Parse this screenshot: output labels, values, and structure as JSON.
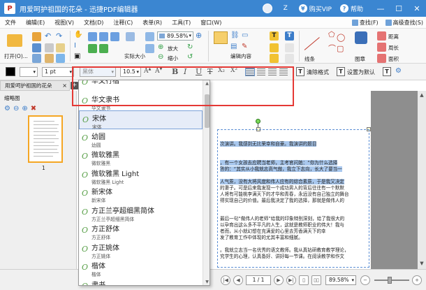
{
  "titlebar": {
    "logo_text": "P",
    "title": "用爱呵护祖国的花朵 - 迅捷PDF编辑器",
    "user_letter": "Z",
    "buy_vip": "购买VIP",
    "help": "帮助",
    "minimize": "—",
    "maximize": "☐",
    "close": "✕"
  },
  "menu": {
    "items": [
      "文件",
      "编辑(E)",
      "视图(V)",
      "文档(D)",
      "注释(C)",
      "表单(R)",
      "工具(T)",
      "窗口(W)"
    ],
    "search": "查找(F)",
    "advanced_search": "高级查找(S)"
  },
  "ribbon": {
    "open_label": "打开(O)...",
    "zoom_value": "89.58%",
    "actual_size": "实际大小",
    "zoom_in": "放大",
    "zoom_out": "缩小",
    "edit_content": "编辑内容",
    "line": "线条",
    "shape": "图章",
    "distance": "距离",
    "perimeter": "周长",
    "area": "面积"
  },
  "format": {
    "line_width": "1 pt",
    "font_placeholder": "黑体",
    "font_size": "10.5",
    "bold": "B",
    "italic": "I",
    "underline": "U",
    "strike": "T",
    "sub": "X₂",
    "sup": "X²",
    "clear_format": "清除格式",
    "set_default": "设置为默认"
  },
  "left_panel": {
    "tab_label": "用爱呵护祖国的花朵",
    "tab_close": "×",
    "tab_add": "+",
    "panel_title": "缩略图",
    "page_number": "1"
  },
  "font_dropdown": {
    "items": [
      {
        "name": "华文行楷",
        "sub": "",
        "style": "serif"
      },
      {
        "name": "华文隶书",
        "sub": "华文隶书",
        "style": "serif"
      },
      {
        "name": "宋体",
        "sub": "宋体",
        "style": "serif"
      },
      {
        "name": "幼圆",
        "sub": "幼圆",
        "style": "sans"
      },
      {
        "name": "微软雅黑",
        "sub": "微软雅黑",
        "style": "sans"
      },
      {
        "name": "微软雅黑 Light",
        "sub": "微软雅黑 Light",
        "style": "sans"
      },
      {
        "name": "新宋体",
        "sub": "新宋体",
        "style": "serif"
      },
      {
        "name": "方正兰亭超细黑简体",
        "sub": "方正兰亭超细黑简体",
        "style": "sans"
      },
      {
        "name": "方正舒体",
        "sub": "方正舒体",
        "style": "serif"
      },
      {
        "name": "方正姚体",
        "sub": "方正姚体",
        "style": "serif"
      },
      {
        "name": "楷体",
        "sub": "楷体",
        "style": "serif"
      },
      {
        "name": "隶书",
        "sub": "隶书",
        "style": "serif"
      }
    ],
    "selected_index": 2
  },
  "document": {
    "lines": [
      {
        "text": "次演讲。我感到无比荣幸和自豪。我演讲的题目",
        "hl": true
      },
      {
        "text": "",
        "hl": false
      },
      {
        "text": "，有一个女孩去应聘当老师，主考官问她：“你为什么选择",
        "hl": true
      },
      {
        "text": "答的：“其实从小我就志高气傲，我立下志向，长大了要当一",
        "hl": true
      },
      {
        "text": "",
        "hl": false
      },
      {
        "text": "人气质，没有大将风度和伟人应有的综合素质，于是我又决定",
        "hl": true
      },
      {
        "text": "的妻子。可是后来我发现一个成功男人的背后往往有一个默默",
        "hl": false
      },
      {
        "text": "人将有可能桃李满天下的才华和青春，永远没有自己独立的舞台",
        "hl": false
      },
      {
        "text": "得实现自己的价值。最后我决定了我的选择，那就是做伟人的",
        "hl": false
      },
      {
        "text": "",
        "hl": false
      },
      {
        "text": "最后一句“做伟人的老师”给我的印象特别深刻，给了我很大的",
        "hl": false
      },
      {
        "text": "以孕育出这么多不平凡的人生，这就是教师职业的伟大！我与",
        "hl": false
      },
      {
        "text": "者而，从小就幻想在充满爱的心里去芳香满天下的幸",
        "hl": false
      },
      {
        "text": "发了教育工作中体现的尤其丰富和细腻。",
        "hl": false
      },
      {
        "text": "。我就立志当一名优秀的语文教师。我从真钻研教育教学理论，",
        "hl": false
      },
      {
        "text": "究学生的心理，认真备好、讲好每一节课。在阅读教学和作文",
        "hl": false
      }
    ]
  },
  "statusbar": {
    "page_value": "1 / 1",
    "zoom_value": "89.58%"
  },
  "colors": {
    "titlebar": "#3b86d1",
    "highlight": "#a9c8ee",
    "annotation_box": "#e53935"
  }
}
